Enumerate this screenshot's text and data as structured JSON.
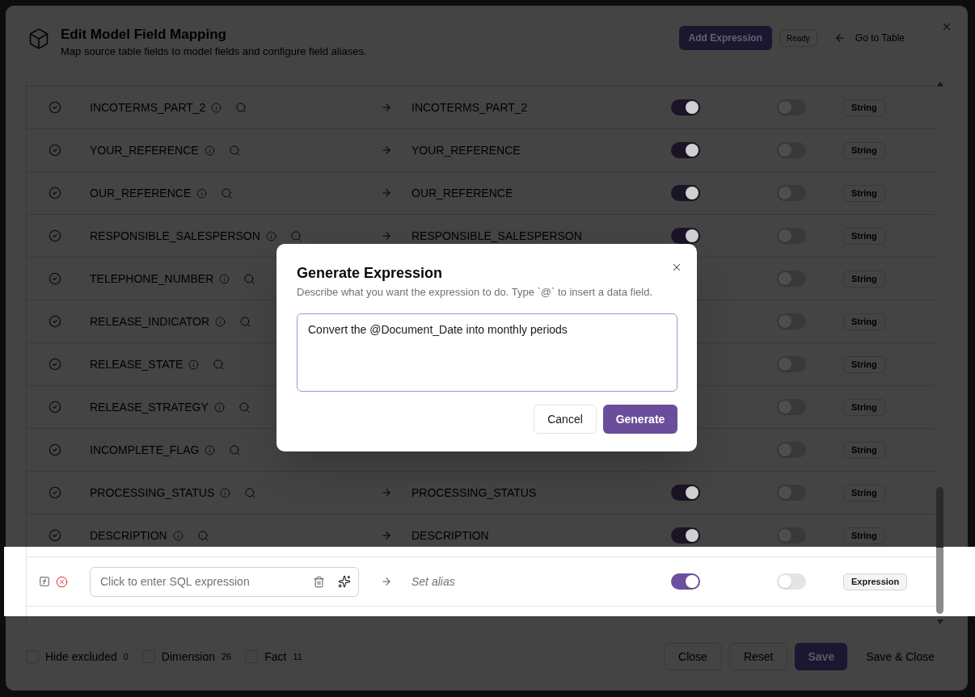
{
  "dialog": {
    "title": "Edit Model Field Mapping",
    "subtitle": "Map source table fields to model fields and configure field aliases.",
    "add_expression_button": "Add Expression",
    "status_badge": "Ready",
    "go_to_table_link": "Go to Table"
  },
  "rows": [
    {
      "kind": "field",
      "source": "INCOTERMS_PART_2",
      "target": "INCOTERMS_PART_2",
      "switch_1": {
        "on": true
      },
      "switch_2": {
        "on": false
      },
      "type": "String",
      "highlighted": false
    },
    {
      "kind": "field",
      "source": "YOUR_REFERENCE",
      "target": "YOUR_REFERENCE",
      "switch_1": {
        "on": true
      },
      "switch_2": {
        "on": false
      },
      "type": "String",
      "highlighted": false
    },
    {
      "kind": "field",
      "source": "OUR_REFERENCE",
      "target": "OUR_REFERENCE",
      "switch_1": {
        "on": true
      },
      "switch_2": {
        "on": false
      },
      "type": "String",
      "highlighted": false
    },
    {
      "kind": "field",
      "source": "RESPONSIBLE_SALESPERSON",
      "target": "RESPONSIBLE_SALESPERSON",
      "switch_1": {
        "on": true
      },
      "switch_2": {
        "on": false
      },
      "type": "String",
      "highlighted": false
    },
    {
      "kind": "field",
      "source": "TELEPHONE_NUMBER",
      "switch_2": {
        "on": false
      },
      "type": "String",
      "highlighted": false
    },
    {
      "kind": "field",
      "source": "RELEASE_INDICATOR",
      "switch_2": {
        "on": false
      },
      "type": "String",
      "highlighted": false
    },
    {
      "kind": "field",
      "source": "RELEASE_STATE",
      "switch_2": {
        "on": false
      },
      "type": "String",
      "highlighted": false
    },
    {
      "kind": "field",
      "source": "RELEASE_STRATEGY",
      "switch_2": {
        "on": false
      },
      "type": "String",
      "highlighted": false
    },
    {
      "kind": "field",
      "source": "INCOMPLETE_FLAG",
      "switch_2": {
        "on": false
      },
      "type": "String",
      "highlighted": false
    },
    {
      "kind": "field",
      "source": "PROCESSING_STATUS",
      "target": "PROCESSING_STATUS",
      "switch_1": {
        "on": true
      },
      "switch_2": {
        "on": false
      },
      "type": "String",
      "highlighted": false
    },
    {
      "kind": "field",
      "source": "DESCRIPTION",
      "target": "DESCRIPTION",
      "switch_1": {
        "on": true
      },
      "switch_2": {
        "on": false
      },
      "type": "String",
      "highlighted": false
    },
    {
      "kind": "expression",
      "placeholder": "Click to enter SQL expression",
      "alias_placeholder": "Set alias",
      "switch_1": {
        "on": true
      },
      "switch_2": {
        "on": false
      },
      "type": "Expression",
      "highlighted": true
    }
  ],
  "footer": {
    "filters": [
      {
        "label": "Hide excluded",
        "count": "0",
        "checked": false
      },
      {
        "label": "Dimension",
        "count": "26",
        "checked": false
      },
      {
        "label": "Fact",
        "count": "11",
        "checked": false
      }
    ],
    "buttons": [
      {
        "label": "Close",
        "kind": "outline"
      },
      {
        "label": "Reset",
        "kind": "outline"
      },
      {
        "label": "Save",
        "kind": "primary"
      },
      {
        "label": "Save & Close",
        "kind": "ghost"
      }
    ]
  },
  "generate_dialog": {
    "title": "Generate Expression",
    "description": "Describe what you want the expression to do. Type `@` to insert a data field.",
    "prompt": "Convert the @Document_Date into monthly periods",
    "buttons": [
      {
        "label": "Cancel",
        "kind": "outline"
      },
      {
        "label": "Generate",
        "kind": "primary"
      }
    ]
  }
}
